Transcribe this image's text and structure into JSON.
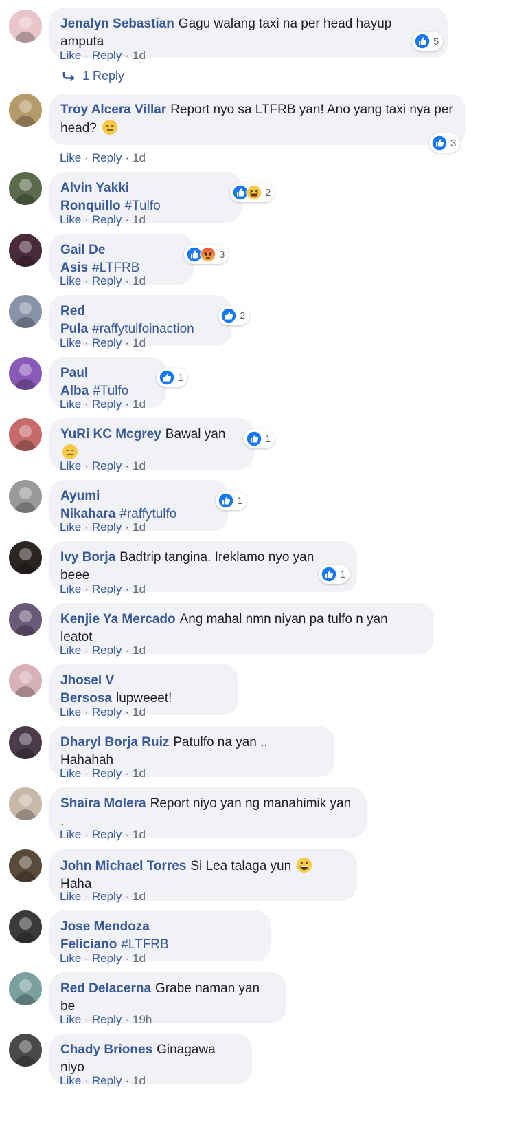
{
  "actions": {
    "like": "Like",
    "reply": "Reply",
    "separator": "·"
  },
  "comments": [
    {
      "name": "Jenalyn Sebastian",
      "parts": [
        {
          "type": "text",
          "value": "Gagu walang taxi na per head hayup amputa"
        }
      ],
      "time": "1d",
      "reactions": {
        "icons": [
          "like"
        ],
        "count": "5"
      },
      "replies_link": "1 Reply",
      "avatar_color": "#e9c4c8"
    },
    {
      "name": "Troy Alcera Villar",
      "parts": [
        {
          "type": "text",
          "value": "Report nyo sa LTFRB yan! Ano yang taxi nya per head?"
        },
        {
          "type": "emoji",
          "value": "expressionless-emoji"
        }
      ],
      "time": "1d",
      "reactions": {
        "icons": [
          "like"
        ],
        "count": "3"
      },
      "avatar_color": "#b59a6a"
    },
    {
      "name": "Alvin Yakki Ronquillo",
      "parts": [
        {
          "type": "hashtag",
          "value": "#Tulfo"
        }
      ],
      "time": "1d",
      "reactions": {
        "icons": [
          "like",
          "haha"
        ],
        "count": "2"
      },
      "avatar_color": "#5b6a4b"
    },
    {
      "name": "Gail De Asis",
      "parts": [
        {
          "type": "hashtag",
          "value": "#LTFRB"
        }
      ],
      "time": "1d",
      "reactions": {
        "icons": [
          "like",
          "angry"
        ],
        "count": "3"
      },
      "avatar_color": "#4a2b3a"
    },
    {
      "name": "Red Pula",
      "parts": [
        {
          "type": "hashtag",
          "value": "#raffytulfoinaction"
        }
      ],
      "time": "1d",
      "reactions": {
        "icons": [
          "like"
        ],
        "count": "2"
      },
      "avatar_color": "#8892a8"
    },
    {
      "name": "Paul Alba",
      "parts": [
        {
          "type": "hashtag",
          "value": "#Tulfo"
        }
      ],
      "time": "1d",
      "reactions": {
        "icons": [
          "like"
        ],
        "count": "1"
      },
      "avatar_color": "#8a5ab8"
    },
    {
      "name": "YuRi KC Mcgrey",
      "parts": [
        {
          "type": "text",
          "value": "Bawal yan"
        },
        {
          "type": "emoji",
          "value": "expressionless-emoji"
        }
      ],
      "time": "1d",
      "reactions": {
        "icons": [
          "like"
        ],
        "count": "1"
      },
      "avatar_color": "#c66a6a"
    },
    {
      "name": "Ayumi Nikahara",
      "parts": [
        {
          "type": "hashtag",
          "value": "#raffytulfo"
        }
      ],
      "time": "1d",
      "reactions": {
        "icons": [
          "like"
        ],
        "count": "1"
      },
      "avatar_color": "#9a9a9a"
    },
    {
      "name": "Ivy Borja",
      "parts": [
        {
          "type": "text",
          "value": "Badtrip tangina. Ireklamo nyo yan beee"
        }
      ],
      "time": "1d",
      "reactions": {
        "icons": [
          "like"
        ],
        "count": "1"
      },
      "avatar_color": "#2d2424"
    },
    {
      "name": "Kenjie Ya Mercado",
      "parts": [
        {
          "type": "text",
          "value": "Ang mahal nmn niyan pa tulfo n yan leatot"
        }
      ],
      "time": "1d",
      "avatar_color": "#6a5a7a"
    },
    {
      "name": "Jhosel V Bersosa",
      "parts": [
        {
          "type": "text",
          "value": "lupweeet!"
        }
      ],
      "time": "1d",
      "avatar_color": "#d8b0b8"
    },
    {
      "name": "Dharyl Borja Ruiz",
      "parts": [
        {
          "type": "text",
          "value": "Patulfo na yan .. Hahahah"
        }
      ],
      "time": "1d",
      "avatar_color": "#4a3a4a"
    },
    {
      "name": "Shaira Molera",
      "parts": [
        {
          "type": "text",
          "value": "Report niyo yan ng manahimik yan ."
        }
      ],
      "time": "1d",
      "avatar_color": "#c8b8a8"
    },
    {
      "name": "John Michael Torres",
      "parts": [
        {
          "type": "text",
          "value": "Si Lea talaga yun"
        },
        {
          "type": "emoji",
          "value": "grinning-emoji"
        },
        {
          "type": "text",
          "value": "Haha"
        }
      ],
      "time": "1d",
      "avatar_color": "#5a4a3a"
    },
    {
      "name": "Jose Mendoza Feliciano",
      "parts": [
        {
          "type": "hashtag",
          "value": "#LTFRB"
        }
      ],
      "time": "1d",
      "avatar_color": "#3a3a3a"
    },
    {
      "name": "Red Delacerna",
      "parts": [
        {
          "type": "text",
          "value": "Grabe naman yan be"
        }
      ],
      "time": "19h",
      "avatar_color": "#7aa0a0"
    },
    {
      "name": "Chady Briones",
      "parts": [
        {
          "type": "text",
          "value": "Ginagawa niyo"
        }
      ],
      "time": "1d",
      "avatar_color": "#4a4a4a"
    }
  ],
  "colors": {
    "link": "#385898",
    "bubble": "#f0f2f5",
    "like": "#1877f2",
    "meta": "#606770"
  }
}
